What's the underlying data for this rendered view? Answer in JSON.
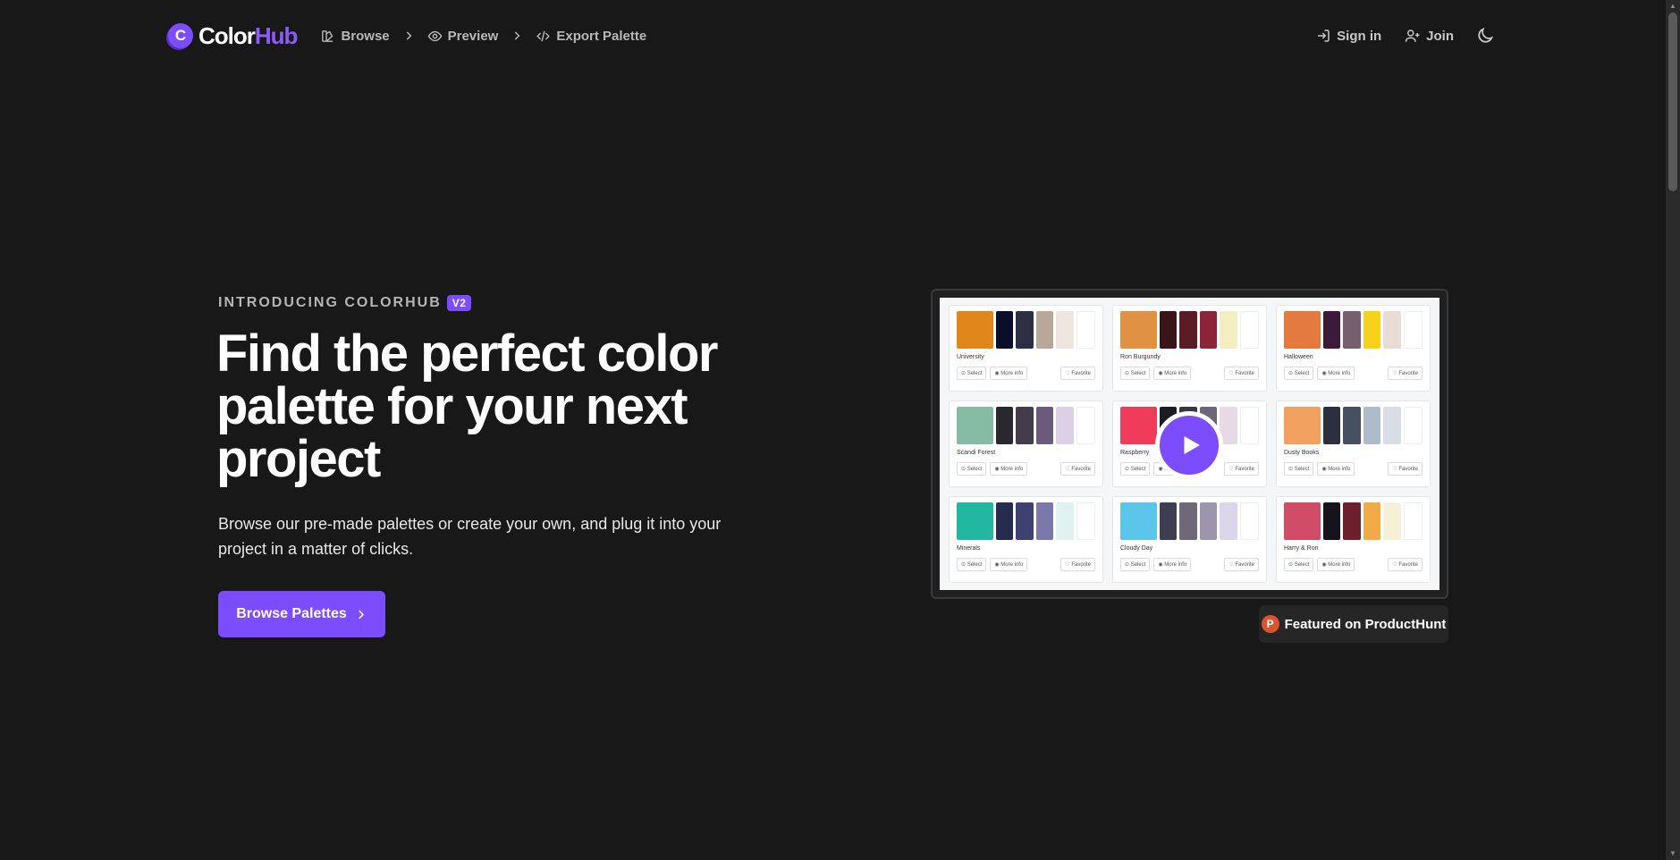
{
  "brand": {
    "name_part1": "Color",
    "name_part2": "Hub",
    "badge_letter": "C",
    "accent": "#7c4dff"
  },
  "breadcrumb": [
    {
      "label": "Browse",
      "icon": "palette-icon"
    },
    {
      "label": "Preview",
      "icon": "eye-icon"
    },
    {
      "label": "Export Palette",
      "icon": "code-icon"
    }
  ],
  "nav_right": {
    "sign_in": "Sign in",
    "join": "Join",
    "theme_icon": "moon-icon"
  },
  "hero": {
    "eyebrow": "INTRODUCING COLORHUB",
    "version_badge": "V2",
    "headline": "Find the perfect color palette for your next project",
    "subtext": "Browse our pre-made palettes or create your own, and plug it into your project in a matter of clicks.",
    "cta_label": "Browse Palettes"
  },
  "preview": {
    "action_labels": {
      "select": "Select",
      "more_info": "More info",
      "favorite": "Favorite"
    },
    "palettes": [
      {
        "name": "University",
        "colors": [
          "#e0861a",
          "#0c0d2a",
          "#2d2f45",
          "#b7a99a",
          "#efe5df",
          "#ffffff"
        ]
      },
      {
        "name": "Ron Burgundy",
        "colors": [
          "#df9144",
          "#3a1416",
          "#5b1a24",
          "#8e2437",
          "#f4eec3",
          "#ffffff"
        ]
      },
      {
        "name": "Halloween",
        "colors": [
          "#e57a3f",
          "#3d1a38",
          "#76606d",
          "#f7d21b",
          "#e8dcd7",
          "#ffffff"
        ]
      },
      {
        "name": "Scandi Forest",
        "colors": [
          "#86bba3",
          "#2b2730",
          "#433c4d",
          "#6a5b7b",
          "#ddd0e6",
          "#ffffff"
        ]
      },
      {
        "name": "Raspberry",
        "colors": [
          "#f03b5a",
          "#1d1b24",
          "#393542",
          "#6c6477",
          "#e7d9e6",
          "#ffffff"
        ]
      },
      {
        "name": "Dusty Books",
        "colors": [
          "#f1a060",
          "#2b2f3e",
          "#465060",
          "#adbbcb",
          "#d8dde6",
          "#ffffff"
        ]
      },
      {
        "name": "Minerals",
        "colors": [
          "#22b8a0",
          "#272c4f",
          "#3f4270",
          "#7a79aa",
          "#e0f2ef",
          "#ffffff"
        ]
      },
      {
        "name": "Cloudy Day",
        "colors": [
          "#5cc5ea",
          "#3f3d52",
          "#6e6879",
          "#9c95ac",
          "#dcd6ea",
          "#ffffff"
        ]
      },
      {
        "name": "Harry & Ron",
        "colors": [
          "#d14d67",
          "#15141a",
          "#6e1f2c",
          "#f0aa46",
          "#f6f0d6",
          "#ffffff"
        ]
      }
    ],
    "play_icon": "play-icon"
  },
  "producthunt": {
    "label": "Featured on ProductHunt",
    "icon_letter": "P",
    "color": "#da552f"
  }
}
